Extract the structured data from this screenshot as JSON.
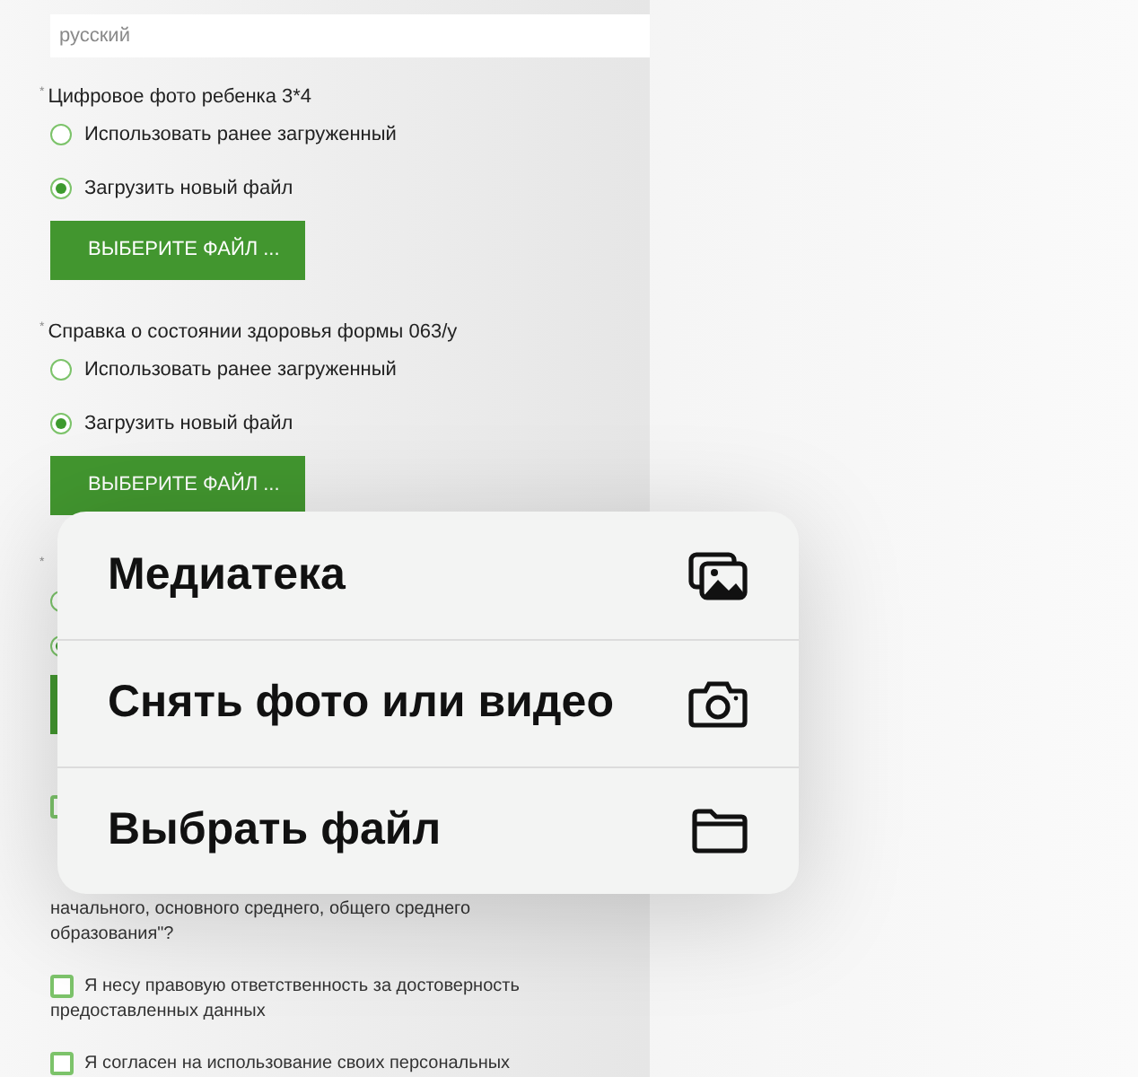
{
  "language_field": {
    "value": "русский"
  },
  "sections": [
    {
      "marker": "*",
      "label": "Цифровое фото ребенка 3*4",
      "options": [
        {
          "label": "Использовать ранее загруженный",
          "selected": false
        },
        {
          "label": "Загрузить новый файл",
          "selected": true
        }
      ],
      "button": "ВЫБЕРИТЕ ФАЙЛ ..."
    },
    {
      "marker": "*",
      "label": "Справка о состоянии здоровья формы 063/у",
      "options": [
        {
          "label": "Использовать ранее загруженный",
          "selected": false
        },
        {
          "label": "Загрузить новый файл",
          "selected": true
        }
      ],
      "button": "ВЫБЕРИТЕ ФАЙЛ ..."
    },
    {
      "marker": "*",
      "options": [
        {
          "selected": false
        },
        {
          "selected": true
        }
      ]
    }
  ],
  "checkboxes": [
    {
      "lines": [
        "начального, основного среднего, общего среднего",
        "образования\"?"
      ],
      "checked": false
    },
    {
      "lines": [
        "Я несу правовую ответственность за достоверность",
        "предоставленных данных"
      ],
      "checked": false
    },
    {
      "lines": [
        "Я согласен на использование своих персональных"
      ],
      "checked": false
    }
  ],
  "menu": [
    {
      "label": "Медиатека",
      "kind": "library"
    },
    {
      "label": "Снять фото или видео",
      "kind": "camera"
    },
    {
      "label": "Выбрать файл",
      "kind": "folder"
    }
  ]
}
